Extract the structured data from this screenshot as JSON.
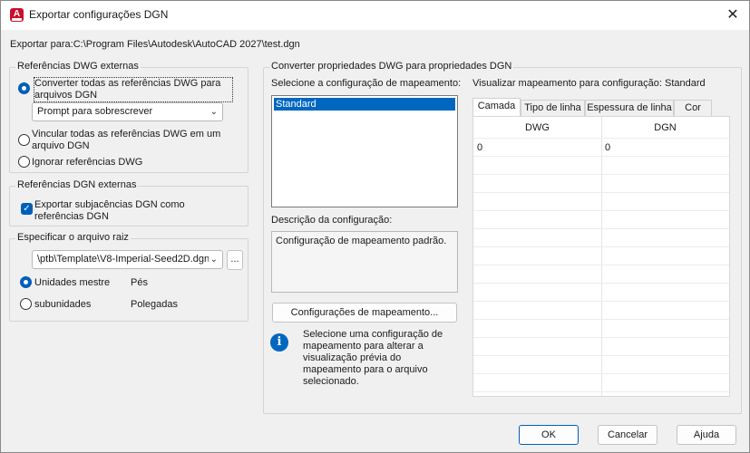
{
  "window": {
    "title": "Exportar configurações DGN",
    "close_glyph": "✕",
    "app_icon_letter": "A"
  },
  "export_path": "Exportar para:C:\\Program Files\\Autodesk\\AutoCAD 2027\\test.dgn",
  "dwg_refs": {
    "title": "Referências DWG externas",
    "opt_convert": "Converter todas as referências DWG para arquivos DGN",
    "prompt_combo": "Prompt para sobrescrever",
    "opt_link": "Vincular todas as referências DWG em um arquivo DGN",
    "opt_ignore": "Ignorar referências DWG"
  },
  "dgn_refs": {
    "title": "Referências DGN externas",
    "check_export": "Exportar subjacências DGN como referências DGN"
  },
  "seed": {
    "title": "Especificar o arquivo raiz",
    "file_combo": "\\ptb\\Template\\V8-Imperial-Seed2D.dgn",
    "browse_label": "...",
    "opt_master": "Unidades mestre",
    "master_value": "Pés",
    "opt_sub": "subunidades",
    "sub_value": "Polegadas"
  },
  "convert": {
    "title": "Converter propriedades DWG para propriedades DGN",
    "select_label": "Selecione a configuração de  mapeamento:",
    "mapping_list": [
      "Standard"
    ],
    "desc_label": "Descrição da configuração:",
    "desc_text": "Configuração de mapeamento padrão.",
    "mapping_button": "Configurações de mapeamento...",
    "info_text": "Selecione uma configuração de mapeamento para alterar a visualização prévia do mapeamento para o arquivo selecionado.",
    "preview_label": "Visualizar mapeamento para configuração: Standard",
    "tabs": [
      "Camada",
      "Tipo de linha",
      "Espessura de linha",
      "Cor"
    ],
    "columns": [
      "DWG",
      "DGN"
    ],
    "rows": [
      [
        "0",
        "0"
      ]
    ]
  },
  "footer": {
    "ok": "OK",
    "cancel": "Cancelar",
    "help": "Ajuda"
  },
  "colors": {
    "accent": "#005fb8",
    "selection": "#0067c0",
    "brand_red": "#c8102e"
  }
}
